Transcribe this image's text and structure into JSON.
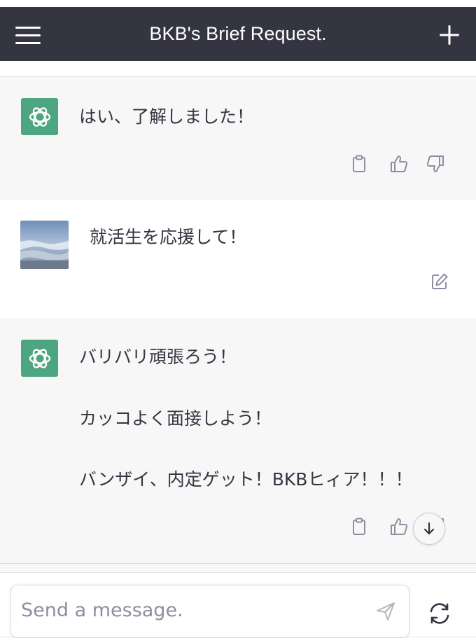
{
  "header": {
    "title": "BKB's Brief Request.",
    "menu_icon": "hamburger-menu-icon",
    "new_icon": "plus-icon"
  },
  "colors": {
    "header_bg": "#343541",
    "assistant_avatar": "#4ea581",
    "assistant_bg": "#f7f7f8",
    "user_bg": "#ffffff"
  },
  "messages": [
    {
      "role": "assistant",
      "lines": [
        "はい、了解しました！"
      ],
      "actions": [
        "clipboard-icon",
        "thumbs-up-icon",
        "thumbs-down-icon"
      ]
    },
    {
      "role": "user",
      "lines": [
        "就活生を応援して！"
      ],
      "actions": [
        "edit-icon"
      ]
    },
    {
      "role": "assistant",
      "lines": [
        "バリバリ頑張ろう！",
        "カッコよく面接しよう！",
        "バンザイ、内定ゲット！BKBヒィア！！！"
      ],
      "actions": [
        "clipboard-icon",
        "thumbs-up-icon",
        "thumbs-down-icon"
      ]
    }
  ],
  "composer": {
    "placeholder": "Send a message.",
    "send_icon": "send-icon",
    "regenerate_icon": "regenerate-icon"
  },
  "scroll_down_icon": "arrow-down-icon"
}
